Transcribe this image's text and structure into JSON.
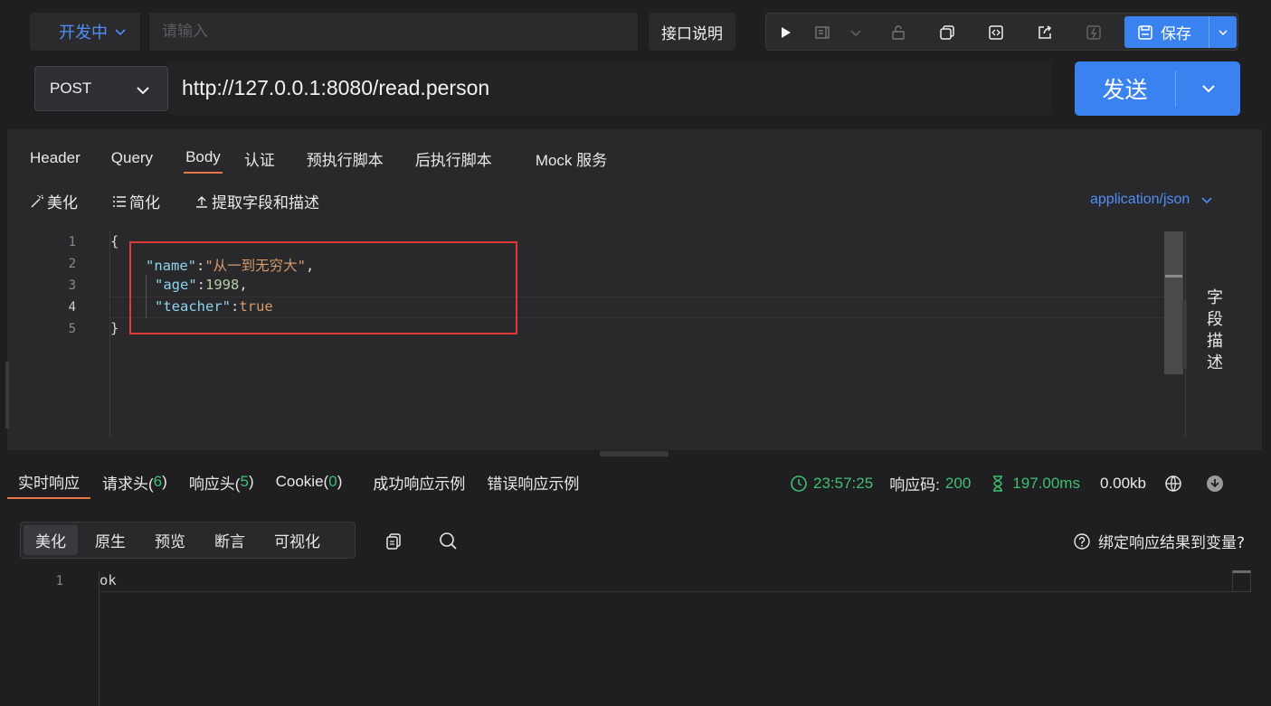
{
  "toolbar": {
    "status": "开发中",
    "name_placeholder": "请输入",
    "doc_button": "接口说明",
    "save_label": "保存"
  },
  "request": {
    "method": "POST",
    "url": "http://127.0.0.1:8080/read.person",
    "send_label": "发送",
    "tabs": [
      "Header",
      "Query",
      "Body",
      "认证",
      "预执行脚本",
      "后执行脚本",
      "Mock 服务"
    ],
    "active_tab": "Body",
    "body_tools": {
      "beautify": "美化",
      "simplify": "简化",
      "extract": "提取字段和描述"
    },
    "content_type": "application/json",
    "line_numbers": [
      "1",
      "2",
      "3",
      "4",
      "5"
    ],
    "body_lines": {
      "open": "{",
      "name_key": "\"name\"",
      "name_value": "\"从一到无穷大\"",
      "age_key": "\"age\"",
      "age_value": "1998",
      "teacher_key": "\"teacher\"",
      "teacher_value": "true",
      "close": "}"
    },
    "side_tab": "字段描述"
  },
  "response": {
    "tabs": {
      "realtime": "实时响应",
      "req_headers": "请求头(",
      "req_headers_count": "6",
      "resp_headers": "响应头(",
      "resp_headers_count": "5",
      "cookie": "Cookie(",
      "cookie_count": "0",
      "close_paren": ")",
      "success_example": "成功响应示例",
      "error_example": "错误响应示例"
    },
    "time": "23:57:25",
    "status_label": "响应码:",
    "status_code": "200",
    "duration": "197.00ms",
    "size": "0.00kb",
    "view_modes": [
      "美化",
      "原生",
      "预览",
      "断言",
      "可视化"
    ],
    "active_view": "美化",
    "bind_var": "绑定响应结果到变量?",
    "line_numbers": [
      "1"
    ],
    "body": "ok"
  },
  "colors": {
    "accent": "#3a82f0",
    "success": "#3fbf74",
    "tab_underline": "#e3764a",
    "highlight_box": "#e0383a"
  }
}
